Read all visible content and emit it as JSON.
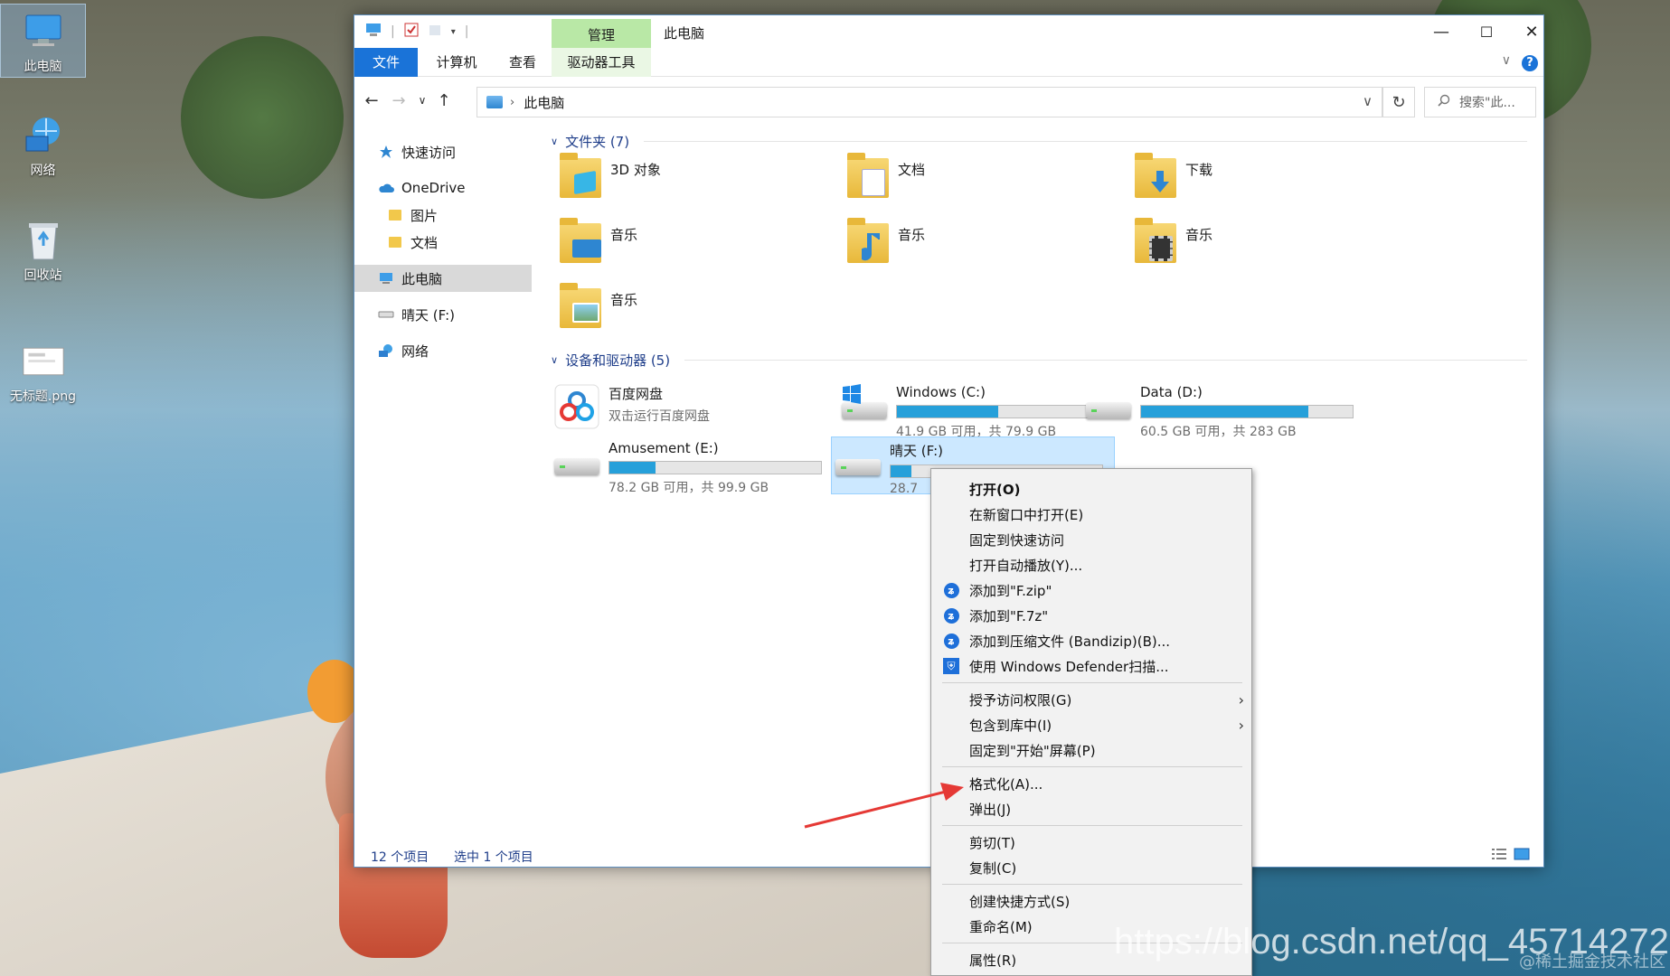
{
  "desktop": {
    "icons": [
      {
        "label": "此电脑",
        "icon": "computer-icon"
      },
      {
        "label": "网络",
        "icon": "network-icon"
      },
      {
        "label": "回收站",
        "icon": "recycle-bin-icon"
      },
      {
        "label": "无标题.png",
        "icon": "image-file-icon"
      }
    ]
  },
  "window": {
    "title": "此电脑",
    "manage_tab": "管理",
    "ribbon_tabs": [
      "文件",
      "计算机",
      "查看",
      "驱动器工具"
    ],
    "controls": {
      "minimize": "—",
      "maximize": "☐",
      "close": "✕"
    },
    "help": "?"
  },
  "nav": {
    "back": "←",
    "forward": "→",
    "recent": "∨",
    "up": "↑",
    "breadcrumb": "此电脑",
    "search_placeholder": "搜索\"此...",
    "refresh": "↻"
  },
  "sidebar": {
    "items": [
      {
        "label": "快速访问",
        "icon": "star-icon"
      },
      {
        "label": "OneDrive",
        "icon": "cloud-icon"
      },
      {
        "label": "图片",
        "icon": "folder-icon"
      },
      {
        "label": "文档",
        "icon": "folder-icon"
      },
      {
        "label": "此电脑",
        "icon": "computer-icon"
      },
      {
        "label": "晴天 (F:)",
        "icon": "drive-icon"
      },
      {
        "label": "网络",
        "icon": "network-icon"
      }
    ]
  },
  "folders": {
    "header": "文件夹 (7)",
    "items": [
      {
        "label": "3D 对象",
        "icon": "3d-objects-folder-icon"
      },
      {
        "label": "文档",
        "icon": "documents-folder-icon"
      },
      {
        "label": "下载",
        "icon": "downloads-folder-icon"
      },
      {
        "label": "音乐",
        "icon": "desktop-folder-icon"
      },
      {
        "label": "音乐",
        "icon": "music-folder-icon"
      },
      {
        "label": "音乐",
        "icon": "videos-folder-icon"
      },
      {
        "label": "音乐",
        "icon": "pictures-folder-icon"
      }
    ]
  },
  "drives": {
    "header": "设备和驱动器 (5)",
    "items": [
      {
        "name": "百度网盘",
        "sub": "双击运行百度网盘",
        "icon": "baidu-netdisk-icon"
      },
      {
        "name": "Windows (C:)",
        "sub": "41.9 GB 可用，共 79.9 GB",
        "used_fraction": 0.48,
        "icon": "windows-drive-icon"
      },
      {
        "name": "Data (D:)",
        "sub": "60.5 GB 可用，共 283 GB",
        "used_fraction": 0.79,
        "icon": "drive-icon"
      },
      {
        "name": "Amusement (E:)",
        "sub": "78.2 GB 可用，共 99.9 GB",
        "used_fraction": 0.22,
        "icon": "drive-icon"
      },
      {
        "name": "晴天 (F:)",
        "sub": "28.7",
        "used_fraction": 0.1,
        "icon": "drive-icon"
      }
    ]
  },
  "status": {
    "count": "12 个项目",
    "selected": "选中 1 个项目"
  },
  "context_menu": {
    "items": [
      {
        "label": "打开(O)"
      },
      {
        "label": "在新窗口中打开(E)"
      },
      {
        "label": "固定到快速访问"
      },
      {
        "label": "打开自动播放(Y)..."
      },
      {
        "label": "添加到\"F.zip\"",
        "icon": "bandizip-icon"
      },
      {
        "label": "添加到\"F.7z\"",
        "icon": "bandizip-icon"
      },
      {
        "label": "添加到压缩文件 (Bandizip)(B)...",
        "icon": "bandizip-icon"
      },
      {
        "label": "使用 Windows Defender扫描...",
        "icon": "defender-shield-icon"
      },
      {
        "label": "授予访问权限(G)"
      },
      {
        "label": "包含到库中(I)"
      },
      {
        "label": "固定到\"开始\"屏幕(P)"
      },
      {
        "label": "格式化(A)..."
      },
      {
        "label": "弹出(J)"
      },
      {
        "label": "剪切(T)"
      },
      {
        "label": "复制(C)"
      },
      {
        "label": "创建快捷方式(S)"
      },
      {
        "label": "重命名(M)"
      },
      {
        "label": "属性(R)"
      }
    ],
    "submenu_arrow": "›"
  },
  "watermark": "https://blog.csdn.net/qq_45714272",
  "watermark_small": "@稀土掘金技术社区",
  "colors": {
    "accent": "#1a73d8",
    "manage_tab": "#b9e8a6",
    "bar_fill": "#26a0da",
    "selection": "#cce8ff",
    "annotation": "#e53935"
  }
}
